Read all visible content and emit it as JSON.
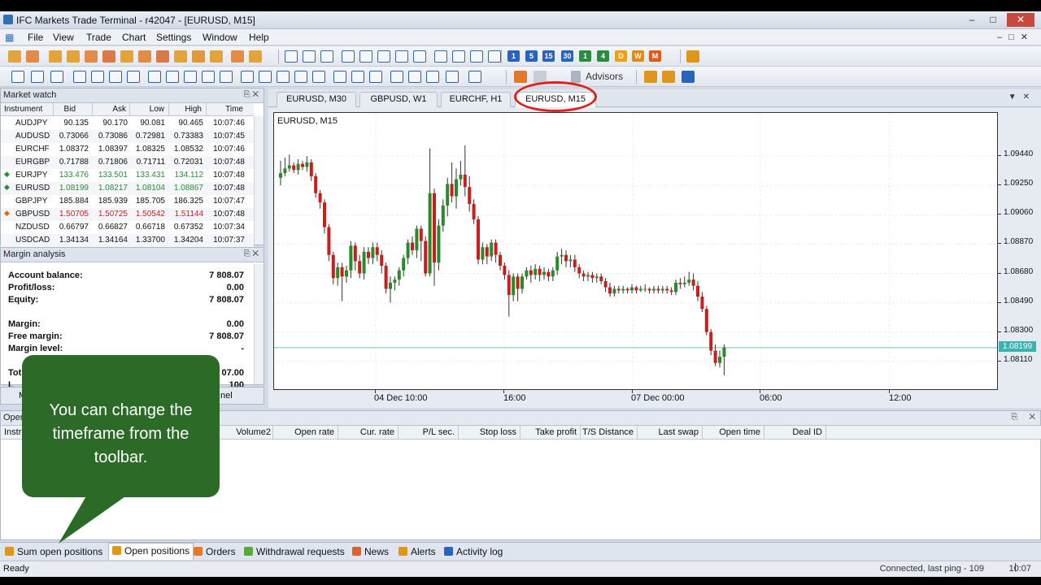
{
  "app": {
    "title": "IFC Markets Trade Terminal - r42047 - [EURUSD, M15]",
    "window_controls": [
      "–",
      "□",
      "✕"
    ]
  },
  "menu": [
    "File",
    "View",
    "Trade",
    "Chart",
    "Settings",
    "Window",
    "Help"
  ],
  "toolbar": {
    "timeframes": [
      "1",
      "5",
      "15",
      "30",
      "1",
      "4",
      "D",
      "W",
      "M"
    ],
    "timeframe_colors": [
      "#2a63b8",
      "#2a63b8",
      "#2a63b8",
      "#2a63b8",
      "#2d8a3e",
      "#2d8a3e",
      "#e7a21a",
      "#e08a1a",
      "#e05a1a"
    ],
    "advisors_label": "Advisors"
  },
  "market_watch": {
    "title": "Market watch",
    "columns": [
      "Instrument",
      "Bid",
      "Ask",
      "Low",
      "High",
      "Time"
    ],
    "rows": [
      {
        "sym": "AUDJPY",
        "bid": "90.135",
        "ask": "90.170",
        "low": "90.081",
        "high": "90.465",
        "time": "10:07:46",
        "dir": "none",
        "color": "#111111"
      },
      {
        "sym": "AUDUSD",
        "bid": "0.73066",
        "ask": "0.73086",
        "low": "0.72981",
        "high": "0.73383",
        "time": "10:07:45",
        "dir": "none",
        "color": "#111111"
      },
      {
        "sym": "EURCHF",
        "bid": "1.08372",
        "ask": "1.08397",
        "low": "1.08325",
        "high": "1.08532",
        "time": "10:07:46",
        "dir": "none",
        "color": "#111111"
      },
      {
        "sym": "EURGBP",
        "bid": "0.71788",
        "ask": "0.71806",
        "low": "0.71711",
        "high": "0.72031",
        "time": "10:07:48",
        "dir": "none",
        "color": "#111111"
      },
      {
        "sym": "EURJPY",
        "bid": "133.476",
        "ask": "133.501",
        "low": "133.431",
        "high": "134.112",
        "time": "10:07:48",
        "dir": "up",
        "color": "#2a8a3a"
      },
      {
        "sym": "EURUSD",
        "bid": "1.08199",
        "ask": "1.08217",
        "low": "1.08104",
        "high": "1.08867",
        "time": "10:07:48",
        "dir": "up",
        "color": "#2a8a3a"
      },
      {
        "sym": "GBPJPY",
        "bid": "185.884",
        "ask": "185.939",
        "low": "185.705",
        "high": "186.325",
        "time": "10:07:47",
        "dir": "none",
        "color": "#111111"
      },
      {
        "sym": "GBPUSD",
        "bid": "1.50705",
        "ask": "1.50725",
        "low": "1.50542",
        "high": "1.51144",
        "time": "10:07:48",
        "dir": "down",
        "color": "#d02020"
      },
      {
        "sym": "NZDUSD",
        "bid": "0.66797",
        "ask": "0.66827",
        "low": "0.66718",
        "high": "0.67352",
        "time": "10:07:34",
        "dir": "none",
        "color": "#111111"
      },
      {
        "sym": "USDCAD",
        "bid": "1.34134",
        "ask": "1.34164",
        "low": "1.33700",
        "high": "1.34204",
        "time": "10:07:37",
        "dir": "none",
        "color": "#111111"
      }
    ]
  },
  "margin_analysis": {
    "title": "Margin analysis",
    "rows": [
      {
        "label": "Account balance:",
        "value": "7 808.07"
      },
      {
        "label": "Profit/loss:",
        "value": "0.00"
      },
      {
        "label": "Equity:",
        "value": "7 808.07"
      },
      {
        "label": "",
        "value": ""
      },
      {
        "label": "Margin:",
        "value": "0.00"
      },
      {
        "label": "Free margin:",
        "value": "7 808.07"
      },
      {
        "label": "Margin level:",
        "value": "-"
      },
      {
        "label": "",
        "value": ""
      },
      {
        "label": "Tot",
        "value": "07.00"
      },
      {
        "label": "L",
        "value": "100"
      }
    ],
    "tab_partial_labels": [
      "M",
      "nel"
    ]
  },
  "chart_tabs": [
    "EURUSD, M30",
    "GBPUSD, W1",
    "EURCHF, H1",
    "EURUSD, M15"
  ],
  "chart_data": {
    "type": "candlestick",
    "title": "EURUSD, M15",
    "price_ticks": [
      "1.09440",
      "1.09250",
      "1.09060",
      "1.08870",
      "1.08680",
      "1.08490",
      "1.08300",
      "1.08110"
    ],
    "current_price": "1.08199",
    "time_ticks": [
      "04 Dec 10:00",
      "16:00",
      "07 Dec 00:00",
      "06:00",
      "12:00"
    ],
    "ylim": [
      1.0793,
      1.0972
    ],
    "candles": [
      [
        1.093,
        1.0933,
        1.0925,
        1.0941
      ],
      [
        1.0933,
        1.0936,
        1.0931,
        1.0943
      ],
      [
        1.0936,
        1.0938,
        1.0934,
        1.0945
      ],
      [
        1.0938,
        1.0935,
        1.0933,
        1.094
      ],
      [
        1.0935,
        1.0939,
        1.0932,
        1.0942
      ],
      [
        1.0939,
        1.0937,
        1.0935,
        1.0941
      ],
      [
        1.0937,
        1.094,
        1.0934,
        1.0944
      ],
      [
        1.094,
        1.0931,
        1.0928,
        1.0942
      ],
      [
        1.0931,
        1.092,
        1.0917,
        1.0933
      ],
      [
        1.092,
        1.0914,
        1.091,
        1.0922
      ],
      [
        1.0914,
        1.0898,
        1.0894,
        1.0916
      ],
      [
        1.0898,
        1.088,
        1.0876,
        1.09
      ],
      [
        1.088,
        1.0865,
        1.0861,
        1.0882
      ],
      [
        1.0865,
        1.0872,
        1.086,
        1.0875
      ],
      [
        1.0872,
        1.0866,
        1.085,
        1.0875
      ],
      [
        1.0866,
        1.087,
        1.0862,
        1.0873
      ],
      [
        1.087,
        1.0886,
        1.0865,
        1.0889
      ],
      [
        1.0886,
        1.0876,
        1.087,
        1.0888
      ],
      [
        1.0876,
        1.0868,
        1.0865,
        1.088
      ],
      [
        1.0868,
        1.0882,
        1.0864,
        1.0885
      ],
      [
        1.0882,
        1.0878,
        1.0874,
        1.0885
      ],
      [
        1.0878,
        1.0885,
        1.0874,
        1.0888
      ],
      [
        1.0885,
        1.088,
        1.0876,
        1.0888
      ],
      [
        1.088,
        1.0873,
        1.0868,
        1.0883
      ],
      [
        1.0873,
        1.0858,
        1.0855,
        1.0875
      ],
      [
        1.0858,
        1.0862,
        1.0849,
        1.0866
      ],
      [
        1.0862,
        1.0864,
        1.0857,
        1.0866
      ],
      [
        1.0864,
        1.087,
        1.086,
        1.0872
      ],
      [
        1.087,
        1.0878,
        1.0866,
        1.088
      ],
      [
        1.0878,
        1.0888,
        1.0874,
        1.089
      ],
      [
        1.0888,
        1.0883,
        1.088,
        1.0892
      ],
      [
        1.0883,
        1.0897,
        1.0878,
        1.0899
      ],
      [
        1.0897,
        1.0889,
        1.0876,
        1.0899
      ],
      [
        1.0889,
        1.0868,
        1.0866,
        1.0892
      ],
      [
        1.0868,
        1.092,
        1.0866,
        1.0949
      ],
      [
        1.092,
        1.0875,
        1.086,
        1.0923
      ],
      [
        1.0875,
        1.0899,
        1.087,
        1.0903
      ],
      [
        1.0899,
        1.0912,
        1.0895,
        1.0916
      ],
      [
        1.0912,
        1.0926,
        1.0905,
        1.093
      ],
      [
        1.0926,
        1.0918,
        1.0914,
        1.094
      ],
      [
        1.0918,
        1.0929,
        1.091,
        1.0936
      ],
      [
        1.0929,
        1.0932,
        1.0925,
        1.0941
      ],
      [
        1.0932,
        1.0924,
        1.0918,
        1.0951
      ],
      [
        1.0924,
        1.0913,
        1.0908,
        1.0931
      ],
      [
        1.0913,
        1.0903,
        1.09,
        1.0916
      ],
      [
        1.0903,
        1.0877,
        1.0874,
        1.0905
      ],
      [
        1.0877,
        1.0885,
        1.0874,
        1.0888
      ],
      [
        1.0885,
        1.0879,
        1.0874,
        1.0887
      ],
      [
        1.0879,
        1.0888,
        1.0876,
        1.089
      ],
      [
        1.0888,
        1.088,
        1.0875,
        1.089
      ],
      [
        1.088,
        1.0873,
        1.087,
        1.0882
      ],
      [
        1.0873,
        1.0867,
        1.0864,
        1.0875
      ],
      [
        1.0867,
        1.0854,
        1.084,
        1.087
      ],
      [
        1.0854,
        1.0866,
        1.085,
        1.0868
      ],
      [
        1.0866,
        1.0858,
        1.085,
        1.0868
      ],
      [
        1.0858,
        1.0866,
        1.0855,
        1.0868
      ],
      [
        1.0866,
        1.087,
        1.0864,
        1.0872
      ],
      [
        1.087,
        1.0867,
        1.0862,
        1.0873
      ],
      [
        1.0867,
        1.0871,
        1.0864,
        1.0874
      ],
      [
        1.0871,
        1.0867,
        1.0863,
        1.0873
      ],
      [
        1.0867,
        1.0869,
        1.0864,
        1.0872
      ],
      [
        1.0869,
        1.0866,
        1.0863,
        1.0871
      ],
      [
        1.0866,
        1.087,
        1.0863,
        1.0872
      ],
      [
        1.087,
        1.0879,
        1.0867,
        1.0882
      ],
      [
        1.0879,
        1.088,
        1.0874,
        1.0884
      ],
      [
        1.088,
        1.0876,
        1.0872,
        1.0883
      ],
      [
        1.0876,
        1.0877,
        1.0872,
        1.088
      ],
      [
        1.0877,
        1.0872,
        1.0869,
        1.088
      ],
      [
        1.0872,
        1.0868,
        1.0865,
        1.0874
      ],
      [
        1.0868,
        1.0866,
        1.0863,
        1.087
      ],
      [
        1.0866,
        1.0867,
        1.0863,
        1.0869
      ],
      [
        1.0867,
        1.0865,
        1.0862,
        1.0869
      ],
      [
        1.0865,
        1.0866,
        1.0862,
        1.0868
      ],
      [
        1.0866,
        1.0863,
        1.0861,
        1.0868
      ],
      [
        1.0863,
        1.0859,
        1.0856,
        1.0865
      ],
      [
        1.0859,
        1.0855,
        1.0853,
        1.0862
      ],
      [
        1.0855,
        1.0858,
        1.0853,
        1.086
      ],
      [
        1.0858,
        1.0857,
        1.0855,
        1.086
      ],
      [
        1.0857,
        1.0858,
        1.0855,
        1.086
      ],
      [
        1.0858,
        1.0857,
        1.0855,
        1.0859
      ],
      [
        1.0857,
        1.0859,
        1.0855,
        1.0861
      ],
      [
        1.0859,
        1.0857,
        1.0855,
        1.086
      ],
      [
        1.0857,
        1.0858,
        1.0856,
        1.086
      ],
      [
        1.0858,
        1.0858,
        1.0856,
        1.0861
      ],
      [
        1.0858,
        1.0857,
        1.0855,
        1.0859
      ],
      [
        1.0857,
        1.0858,
        1.0855,
        1.086
      ],
      [
        1.0858,
        1.0857,
        1.0855,
        1.086
      ],
      [
        1.0857,
        1.0858,
        1.0855,
        1.086
      ],
      [
        1.0858,
        1.0857,
        1.0855,
        1.086
      ],
      [
        1.0857,
        1.0856,
        1.0854,
        1.0859
      ],
      [
        1.0856,
        1.0862,
        1.0854,
        1.0864
      ],
      [
        1.0862,
        1.0861,
        1.0858,
        1.0865
      ],
      [
        1.0861,
        1.0862,
        1.0859,
        1.0866
      ],
      [
        1.0862,
        1.0864,
        1.086,
        1.0869
      ],
      [
        1.0864,
        1.086,
        1.0857,
        1.0868
      ],
      [
        1.086,
        1.0853,
        1.085,
        1.0863
      ],
      [
        1.0853,
        1.0845,
        1.0843,
        1.0856
      ],
      [
        1.0845,
        1.083,
        1.0828,
        1.0847
      ],
      [
        1.083,
        1.0818,
        1.0815,
        1.0832
      ],
      [
        1.0818,
        1.081,
        1.0808,
        1.0822
      ],
      [
        1.081,
        1.0814,
        1.0807,
        1.0818
      ],
      [
        1.0814,
        1.082,
        1.0802,
        1.0822
      ]
    ]
  },
  "open_positions": {
    "title": "Open",
    "columns": [
      "Instr",
      "Volume2",
      "Open rate",
      "Cur. rate",
      "P/L sec.",
      "Stop loss",
      "Take profit",
      "T/S Distance",
      "Last swap",
      "Open time",
      "Deal ID"
    ]
  },
  "bottom_tabs": [
    {
      "label": "Sum open positions",
      "color": "#e0961a"
    },
    {
      "label": "Open positions",
      "color": "#e0961a"
    },
    {
      "label": "Orders",
      "color": "#e07a2a"
    },
    {
      "label": "Withdrawal requests",
      "color": "#5aa83a"
    },
    {
      "label": "News",
      "color": "#d9642a"
    },
    {
      "label": "Alerts",
      "color": "#e0961a"
    },
    {
      "label": "Activity log",
      "color": "#2a63b8"
    }
  ],
  "status": {
    "left": "Ready",
    "connection": "Connected, last ping - 109",
    "time": "10:07"
  },
  "callout": {
    "text": "You can change the timeframe from the toolbar."
  }
}
